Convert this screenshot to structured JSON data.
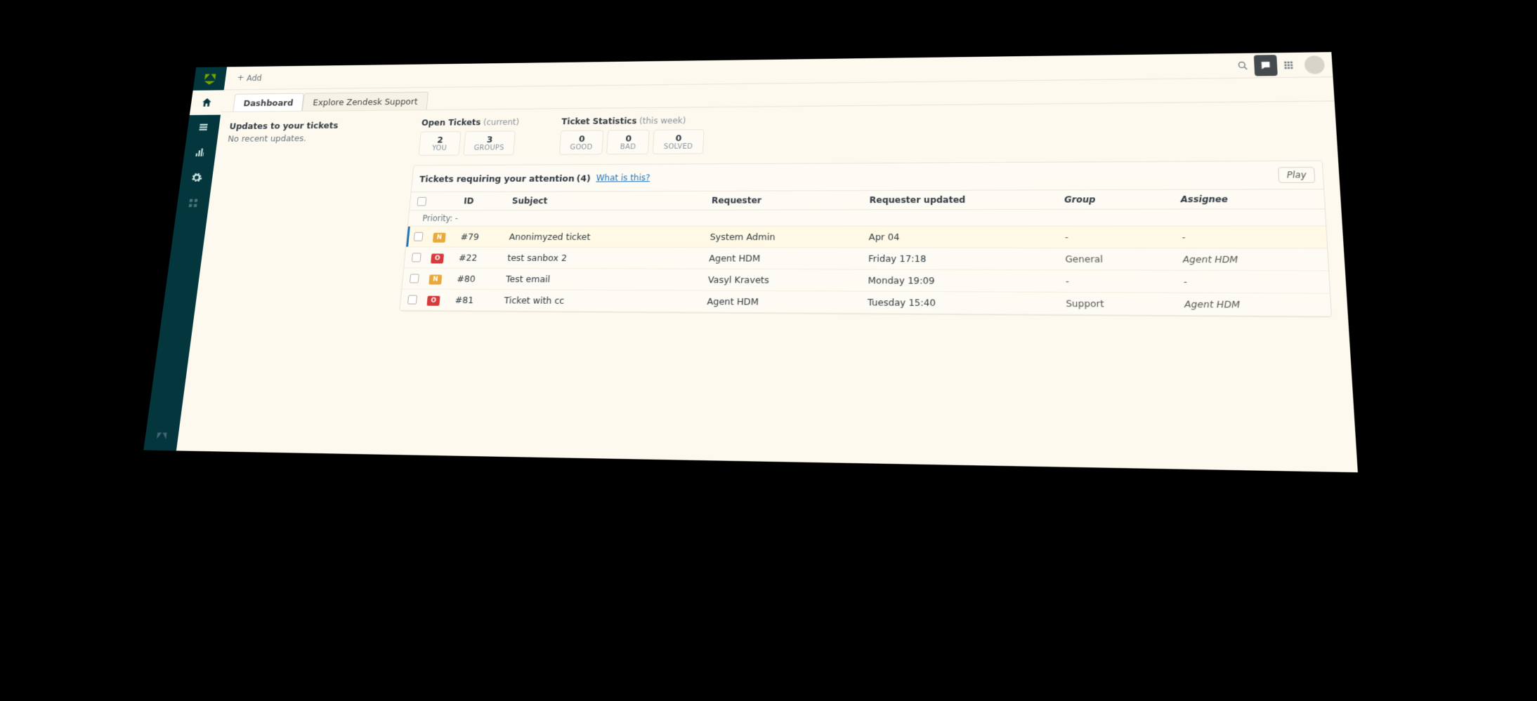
{
  "topbar": {
    "add_label": "Add"
  },
  "tabs": {
    "dashboard": "Dashboard",
    "explore": "Explore Zendesk Support"
  },
  "updates": {
    "title": "Updates to your tickets",
    "text": "No recent updates."
  },
  "stats": {
    "open": {
      "title": "Open Tickets",
      "subtitle": "(current)",
      "items": [
        {
          "value": "2",
          "label": "YOU"
        },
        {
          "value": "3",
          "label": "GROUPS"
        }
      ]
    },
    "tickets": {
      "title": "Ticket Statistics",
      "subtitle": "(this week)",
      "items": [
        {
          "value": "0",
          "label": "GOOD"
        },
        {
          "value": "0",
          "label": "BAD"
        },
        {
          "value": "0",
          "label": "SOLVED"
        }
      ]
    }
  },
  "attention": {
    "title": "Tickets requiring your attention",
    "count": "(4)",
    "what": "What is this?",
    "play": "Play",
    "columns": {
      "id": "ID",
      "subject": "Subject",
      "requester": "Requester",
      "updated": "Requester updated",
      "group": "Group",
      "assignee": "Assignee"
    },
    "priority_label": "Priority: -",
    "rows": [
      {
        "selected": true,
        "badge": "N",
        "badge_class": "n",
        "id": "#79",
        "subject": "Anonimyzed ticket",
        "requester": "System Admin",
        "updated": "Apr 04",
        "group": "-",
        "assignee": "-"
      },
      {
        "selected": false,
        "badge": "O",
        "badge_class": "o",
        "id": "#22",
        "subject": "test sanbox 2",
        "requester": "Agent HDM",
        "updated": "Friday 17:18",
        "group": "General",
        "assignee": "Agent HDM"
      },
      {
        "selected": false,
        "badge": "N",
        "badge_class": "n",
        "id": "#80",
        "subject": "Test email",
        "requester": "Vasyl Kravets",
        "updated": "Monday 19:09",
        "group": "-",
        "assignee": "-"
      },
      {
        "selected": false,
        "badge": "O",
        "badge_class": "o",
        "id": "#81",
        "subject": "Ticket with cc",
        "requester": "Agent HDM",
        "updated": "Tuesday 15:40",
        "group": "Support",
        "assignee": "Agent HDM"
      }
    ]
  }
}
